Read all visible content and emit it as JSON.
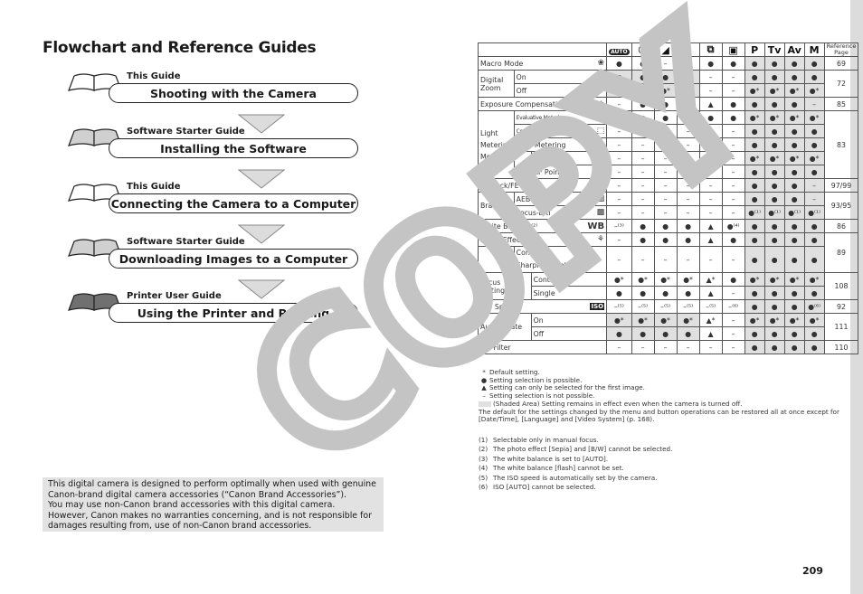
{
  "page": {
    "title": "Flowchart and Reference Guides",
    "page_number": "209",
    "watermark": "COPY"
  },
  "flowchart": [
    {
      "guide": "This Guide",
      "step": "Shooting with the Camera",
      "book_color": "#ffffff"
    },
    {
      "guide": "Software Starter Guide",
      "step": "Installing the Software",
      "book_color": "#d0d0d0"
    },
    {
      "guide": "This Guide",
      "step": "Connecting the Camera to a Computer",
      "book_color": "#ffffff"
    },
    {
      "guide": "Software Starter Guide",
      "step": "Downloading Images to a Computer",
      "book_color": "#d0d0d0"
    },
    {
      "guide": "Printer User Guide",
      "step": "Using the Printer and Printing",
      "book_color": "#707070"
    }
  ],
  "notice": [
    "This digital camera is designed to perform optimally when used with genuine",
    "Canon-brand digital camera accessories (“Canon Brand Accessories”).",
    "You may use non-Canon brand accessories with this digital camera.",
    "However, Canon makes no warranties concerning, and is not responsible for",
    "damages resulting from, use of non-Canon brand accessories."
  ],
  "table": {
    "modes": [
      {
        "name": "auto-mode",
        "label": "AUTO"
      },
      {
        "name": "portrait-mode",
        "label": "☺"
      },
      {
        "name": "landscape-mode",
        "label": "◢"
      },
      {
        "name": "night-scene-mode",
        "label": "✶"
      },
      {
        "name": "stitch-assist-mode",
        "label": "⧉"
      },
      {
        "name": "movie-mode",
        "label": "▣"
      },
      {
        "name": "program-mode",
        "label": "P"
      },
      {
        "name": "shutter-priority-mode",
        "label": "Tv"
      },
      {
        "name": "aperture-priority-mode",
        "label": "Av"
      },
      {
        "name": "manual-mode",
        "label": "M"
      }
    ],
    "reference_header": "Reference Page",
    "rows": {
      "macro": {
        "label": "Macro Mode",
        "icon": "❀",
        "cells": [
          "●",
          "●",
          "–",
          "●",
          "●",
          "●",
          "●",
          "●",
          "●",
          "●"
        ],
        "ref": "69"
      },
      "dzoom_on": {
        "group": "Digital Zoom",
        "label": "On",
        "cells": [
          "●",
          "●",
          "●",
          "●",
          "–",
          "–",
          "●",
          "●",
          "●",
          "●"
        ],
        "ref": "72"
      },
      "dzoom_off": {
        "label": "Off",
        "cells": [
          "●*",
          "●*",
          "●*",
          "●*",
          "–",
          "–",
          "●*",
          "●*",
          "●*",
          "●*"
        ]
      },
      "expcomp": {
        "label": "Exposure Compensation",
        "icon": "±",
        "cells": [
          "–",
          "●",
          "●",
          "●",
          "▲",
          "●",
          "●",
          "●",
          "●",
          "–"
        ],
        "ref": "85"
      },
      "meter_eval": {
        "group": "Light Metering Method",
        "label": "Evaluative Metering",
        "icon": "◉",
        "cells": [
          "●",
          "●",
          "●",
          "●",
          "●",
          "●",
          "●*",
          "●*",
          "●*",
          "●*"
        ],
        "ref": "83"
      },
      "meter_cw": {
        "label": "Center-Weighted Averaging",
        "icon": "⬚",
        "cells": [
          "–",
          "–",
          "–",
          "–",
          "–",
          "–",
          "●",
          "●",
          "●",
          "●"
        ]
      },
      "meter_spot": {
        "label": "Spot Metering",
        "icon": "⊙",
        "cells": [
          "–",
          "–",
          "–",
          "–",
          "–",
          "–",
          "●",
          "●",
          "●",
          "●"
        ]
      },
      "spot_center": {
        "label": "Center",
        "cells": [
          "–",
          "–",
          "–",
          "–",
          "–",
          "–",
          "●*",
          "●*",
          "●*",
          "●*"
        ]
      },
      "spot_af": {
        "label": "AF Point",
        "cells": [
          "–",
          "–",
          "–",
          "–",
          "–",
          "–",
          "●",
          "●",
          "●",
          "●"
        ]
      },
      "aelock": {
        "label": "AE Lock/FE Lock",
        "icon": "✱",
        "cells": [
          "–",
          "–",
          "–",
          "–",
          "–",
          "–",
          "●",
          "●",
          "●",
          "–"
        ],
        "ref": "97/99"
      },
      "aeb": {
        "group": "Bracket",
        "label": "AEB",
        "icon": "▨",
        "cells": [
          "–",
          "–",
          "–",
          "–",
          "–",
          "–",
          "●",
          "●",
          "●",
          "–"
        ],
        "ref": "93/95"
      },
      "focusbkt": {
        "label": "Focus-BKT",
        "icon": "▩",
        "cells": [
          "–",
          "–",
          "–",
          "–",
          "–",
          "–",
          "●⁽¹⁾",
          "●⁽¹⁾",
          "●⁽¹⁾",
          "●⁽¹⁾"
        ]
      },
      "wb": {
        "label": "White Balance⁽²⁾",
        "icon": "WB",
        "cells": [
          "–⁽³⁾",
          "●",
          "●",
          "●",
          "▲",
          "●⁽⁴⁾",
          "●",
          "●",
          "●",
          "●"
        ],
        "ref": "86"
      },
      "photoeffect": {
        "label": "Photo Effect",
        "icon": "⚘",
        "cells": [
          "–",
          "●",
          "●",
          "●",
          "▲",
          "●",
          "●",
          "●",
          "●",
          "●"
        ],
        "ref": "89"
      },
      "contrast": {
        "label_lines": [
          "Contrast/",
          "Sharpness/Saturation"
        ],
        "cells": [
          "–",
          "–",
          "–",
          "–",
          "–",
          "–",
          "●",
          "●",
          "●",
          "●"
        ]
      },
      "focus_cont": {
        "group": "Focus settings",
        "label": "Continuous",
        "cells": [
          "●*",
          "●*",
          "●*",
          "●*",
          "▲*",
          "●",
          "●*",
          "●*",
          "●*",
          "●*"
        ],
        "ref": "108"
      },
      "focus_single": {
        "label": "Single",
        "cells": [
          "●",
          "●",
          "●",
          "●",
          "▲",
          "–",
          "●",
          "●",
          "●",
          "●"
        ]
      },
      "iso": {
        "label": "ISO Speed",
        "icon": "ISO",
        "cells": [
          "–⁽⁵⁾",
          "–⁽⁵⁾",
          "–⁽⁵⁾",
          "–⁽⁵⁾",
          "–⁽⁵⁾",
          "–⁽⁶⁾",
          "●",
          "●",
          "●",
          "●⁽⁶⁾"
        ],
        "ref": "92"
      },
      "rotate_on": {
        "group": "Auto Rotate",
        "label": "On",
        "cells": [
          "●*",
          "●*",
          "●*",
          "●*",
          "▲*",
          "–",
          "●*",
          "●*",
          "●*",
          "●*"
        ],
        "ref": "111"
      },
      "rotate_off": {
        "label": "Off",
        "cells": [
          "●",
          "●",
          "●",
          "●",
          "▲",
          "–",
          "●",
          "●",
          "●",
          "●"
        ]
      },
      "ndfilter": {
        "label": "ND Filter",
        "cells": [
          "–",
          "–",
          "–",
          "–",
          "–",
          "–",
          "●",
          "●",
          "●",
          "●"
        ],
        "ref": "110"
      }
    }
  },
  "legend": [
    {
      "symbol": "*",
      "text": "Default setting."
    },
    {
      "symbol": "●",
      "text": "Setting selection is possible."
    },
    {
      "symbol": "▲",
      "text": "Setting can only be selected for the first image."
    },
    {
      "symbol": "–",
      "text": "Setting selection is not possible."
    }
  ],
  "shaded_legend": "(Shaded Area)    Setting remains in effect even when the camera is turned off.",
  "default_note": [
    "The default for the settings changed by the menu and button operations can be restored all at once except for",
    "[Date/Time], [Language] and [Video System] (p. 168)."
  ],
  "footnotes": [
    {
      "num": "(1)",
      "text": "Selectable only in manual focus."
    },
    {
      "num": "(2)",
      "text": "The photo effect [Sepia] and [B/W] cannot be selected."
    },
    {
      "num": "(3)",
      "text": "The white balance is set to [AUTO]."
    },
    {
      "num": "(4)",
      "text": "The white balance [flash] cannot be set."
    },
    {
      "num": "(5)",
      "text": "The ISO speed is automatically set by the camera."
    },
    {
      "num": "(6)",
      "text": "ISO [AUTO] cannot be selected."
    }
  ]
}
